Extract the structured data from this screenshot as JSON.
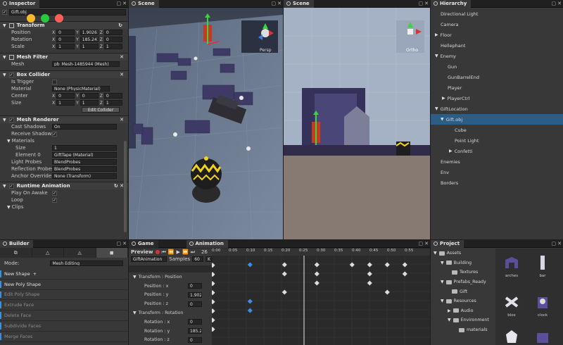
{
  "window_controls": {
    "yellow": "#f5b92a",
    "green": "#27c93f",
    "red": "#ff5f57"
  },
  "inspector": {
    "tab": "Inspector",
    "object_name": "Gift.obj",
    "transform": {
      "title": "Transform",
      "position": {
        "label": "Position",
        "x": "0",
        "y": "1.90261",
        "z": "0"
      },
      "rotation": {
        "label": "Rotation",
        "x": "0",
        "y": "185.241",
        "z": "0"
      },
      "scale": {
        "label": "Scale",
        "x": "1",
        "y": "1",
        "z": "1"
      }
    },
    "mesh_filter": {
      "title": "Mesh Filter",
      "mesh_label": "Mesh",
      "mesh_value": "pb_Mesh-1485944 (Mesh)"
    },
    "box_collider": {
      "title": "Box Collider",
      "is_trigger": "Is Trigger",
      "material_label": "Material",
      "material_value": "None (PhysicMaterial)",
      "center_label": "Center",
      "center": {
        "x": "0",
        "y": "0",
        "z": "0"
      },
      "size_label": "Size",
      "size": {
        "x": "1",
        "y": "1",
        "z": "1"
      },
      "edit_button": "Edit Collider"
    },
    "mesh_renderer": {
      "title": "Mesh Renderer",
      "cast_label": "Cast Shadows",
      "cast_value": "On",
      "receive_label": "Receive Shadows",
      "materials_label": "Materials",
      "size_label": "Size",
      "size_value": "1",
      "element_label": "Element 0",
      "element_value": "GiftTape (Material)",
      "light_probes_label": "Light Probes",
      "light_probes_value": "BlendProbes",
      "reflection_label": "Reflection Probes",
      "reflection_value": "BlendProbes",
      "anchor_label": "Anchor Override",
      "anchor_value": "None (Transform)"
    },
    "runtime_animation": {
      "title": "Runtime Animation",
      "play_label": "Play On Awake",
      "loop_label": "Loop",
      "clips_label": "Clips"
    }
  },
  "scene1": {
    "tab": "Scene",
    "gizmo_label": "Persp"
  },
  "scene2": {
    "tab": "Scene",
    "gizmo_label": "Ortho"
  },
  "hierarchy": {
    "tab": "Hierarchy",
    "items": [
      {
        "label": "Directional Light"
      },
      {
        "label": "Camera"
      },
      {
        "label": "Floor"
      },
      {
        "label": "Hellephant"
      },
      {
        "label": "Enemy"
      },
      {
        "label": "Gun"
      },
      {
        "label": "GunBarrelEnd"
      },
      {
        "label": "Player"
      },
      {
        "label": "PlayerCtrl"
      },
      {
        "label": "GiftLocation"
      },
      {
        "label": "Gift.obj"
      },
      {
        "label": "Cube"
      },
      {
        "label": "Point Light"
      },
      {
        "label": "Confetti"
      },
      {
        "label": "Enemies"
      },
      {
        "label": "Env"
      },
      {
        "label": "Borders"
      }
    ]
  },
  "builder": {
    "tab": "Builder",
    "mode_label": "Mode:",
    "mode_value": "Mesh Editing",
    "buttons": [
      {
        "label": "New Shape"
      },
      {
        "label": "New Poly Shape"
      },
      {
        "label": "Edit Poly Shape"
      },
      {
        "label": "Extrude Face"
      },
      {
        "label": "Delete Face"
      },
      {
        "label": "Subdivide Faces"
      },
      {
        "label": "Merge Faces"
      }
    ]
  },
  "game_tab": "Game",
  "animation": {
    "tab": "Animation",
    "preview": "Preview",
    "frame": "26",
    "clip": "GiftAnimation",
    "samples_label": "Samples",
    "samples_value": "60",
    "k_button": "K",
    "ruler": [
      "0:00",
      "0:05",
      "0:10",
      "0:15",
      "0:20",
      "0:25",
      "0:30",
      "0:35",
      "0:40",
      "0:45",
      "0:50",
      "0:55"
    ],
    "properties": [
      {
        "label": "Transform : Position",
        "value": ""
      },
      {
        "label": "Position : x",
        "value": "0"
      },
      {
        "label": "Position : y",
        "value": "1.9026"
      },
      {
        "label": "Position : z",
        "value": "0"
      },
      {
        "label": "Transform : Rotation",
        "value": ""
      },
      {
        "label": "Rotation : x",
        "value": "0"
      },
      {
        "label": "Rotation : y",
        "value": "185.24"
      },
      {
        "label": "Rotation : z",
        "value": "0"
      }
    ]
  },
  "project": {
    "tab": "Project",
    "tree": [
      {
        "label": "Assets"
      },
      {
        "label": "Building"
      },
      {
        "label": "Textures"
      },
      {
        "label": "Prefabs_Ready"
      },
      {
        "label": "Gift"
      },
      {
        "label": "Resources"
      },
      {
        "label": "Audio"
      },
      {
        "label": "Environment"
      },
      {
        "label": "materials"
      }
    ],
    "assets": [
      {
        "label": "arches"
      },
      {
        "label": "bar"
      },
      {
        "label": "blox"
      },
      {
        "label": "clock"
      }
    ]
  }
}
